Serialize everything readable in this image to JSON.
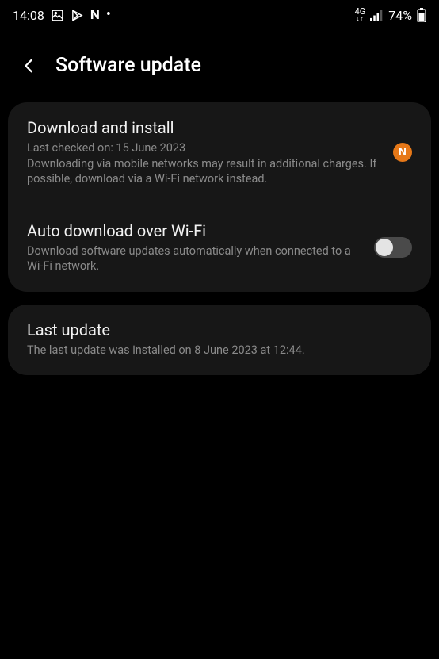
{
  "status": {
    "time": "14:08",
    "network_label": "4G",
    "battery_percent": "74%"
  },
  "header": {
    "title": "Software update"
  },
  "download": {
    "title": "Download and install",
    "last_checked": "Last checked on: 15 June 2023",
    "description": "Downloading via mobile networks may result in additional charges. If possible, download via a Wi-Fi network instead.",
    "badge": "N"
  },
  "auto": {
    "title": "Auto download over Wi-Fi",
    "description": "Download software updates automatically when connected to a Wi-Fi network.",
    "enabled": false
  },
  "last_update": {
    "title": "Last update",
    "description": "The last update was installed on 8 June 2023 at 12:44."
  }
}
